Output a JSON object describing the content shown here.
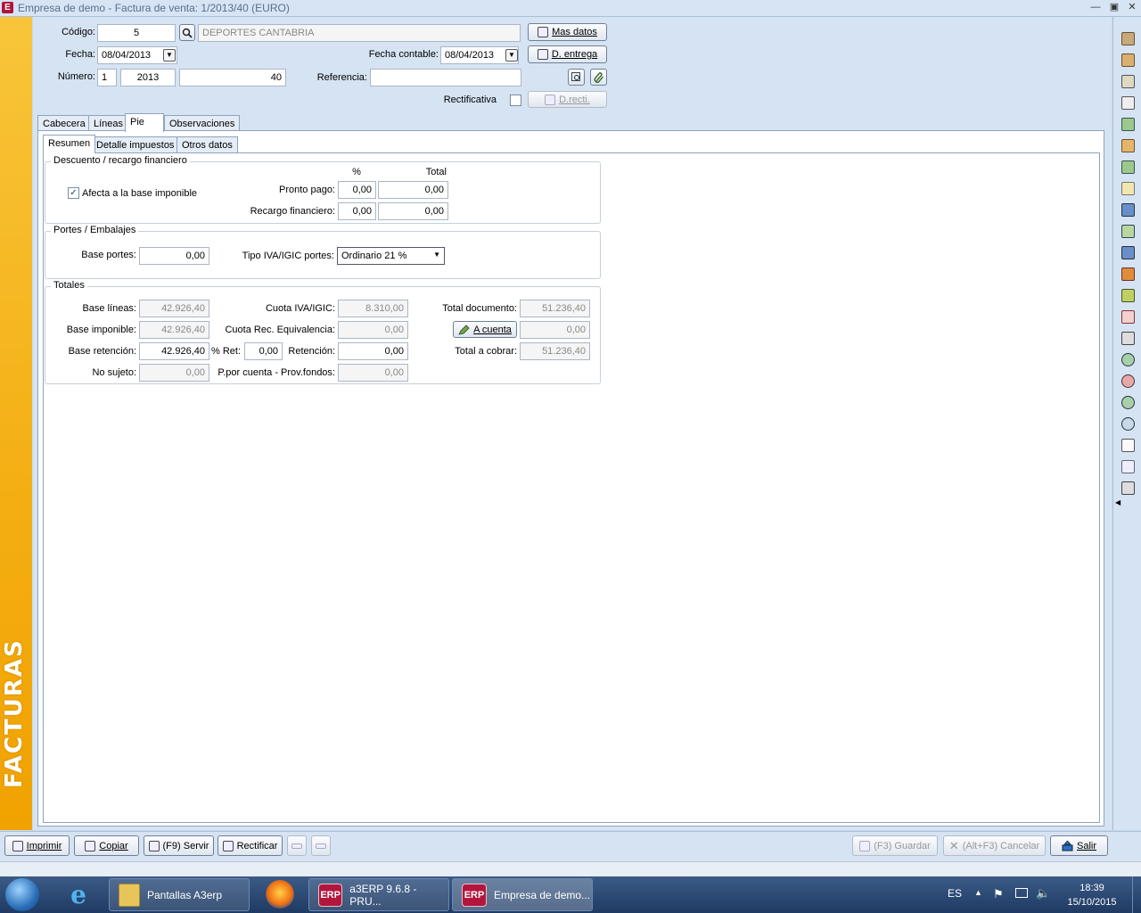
{
  "window": {
    "app_icon_letter": "E",
    "title": "Empresa de demo - Factura de venta: 1/2013/40 (EURO)"
  },
  "banner_text": "FACTURAS",
  "header": {
    "codigo_label": "Código:",
    "codigo_value": "5",
    "cliente_value": "DEPORTES CANTABRIA",
    "mas_datos_label": "Mas datos",
    "fecha_label": "Fecha:",
    "fecha_value": "08/04/2013",
    "fecha_contable_label": "Fecha contable:",
    "fecha_contable_value": "08/04/2013",
    "d_entrega_label": "D. entrega",
    "numero_label": "Número:",
    "numero_serie": "1",
    "numero_anio": "2013",
    "numero_num": "40",
    "referencia_label": "Referencia:",
    "referencia_value": "",
    "rectificativa_label": "Rectificativa",
    "d_recti_label": "D.recti."
  },
  "tabs": [
    "Cabecera",
    "Líneas",
    "Pie",
    "Observaciones"
  ],
  "subtabs": [
    "Resumen",
    "Detalle impuestos",
    "Otros datos"
  ],
  "descuento": {
    "legend": "Descuento / recargo financiero",
    "col_pct": "%",
    "col_total": "Total",
    "afecta_label": "Afecta a la base imponible",
    "afecta_checked": "✓",
    "pronto_label": "Pronto pago:",
    "pronto_pct": "0,00",
    "pronto_total": "0,00",
    "recargo_label": "Recargo financiero:",
    "recargo_pct": "0,00",
    "recargo_total": "0,00"
  },
  "portes": {
    "legend": "Portes / Embalajes",
    "base_label": "Base portes:",
    "base_value": "0,00",
    "tipo_label": "Tipo IVA/IGIC portes:",
    "tipo_value": "Ordinario 21 %"
  },
  "totales": {
    "legend": "Totales",
    "base_lineas_label": "Base líneas:",
    "base_lineas": "42.926,40",
    "base_imponible_label": "Base imponible:",
    "base_imponible": "42.926,40",
    "base_retencion_label": "Base retención:",
    "base_retencion": "42.926,40",
    "pct_ret_label": "% Ret:",
    "pct_ret": "0,00",
    "no_sujeto_label": "No sujeto:",
    "no_sujeto": "0,00",
    "cuota_iva_label": "Cuota IVA/IGIC:",
    "cuota_iva": "8.310,00",
    "cuota_rec_label": "Cuota Rec. Equivalencia:",
    "cuota_rec": "0,00",
    "retencion_label": "Retención:",
    "retencion": "0,00",
    "ppc_label": "P.por cuenta - Prov.fondos:",
    "ppc": "0,00",
    "total_doc_label": "Total documento:",
    "total_doc": "51.236,40",
    "a_cuenta_label": "A cuenta",
    "a_cuenta": "0,00",
    "total_cobrar_label": "Total a cobrar:",
    "total_cobrar": "51.236,40"
  },
  "bottom": {
    "imprimir": "Imprimir",
    "copiar": "Copiar",
    "servir": "(F9) Servir",
    "rectificar": "Rectificar",
    "guardar": "(F3) Guardar",
    "cancelar": "(Alt+F3) Cancelar",
    "salir": "Salir"
  },
  "taskbar": {
    "pantallas": "Pantallas A3erp",
    "erp_icon": "ERP",
    "erp1": "a3ERP 9.6.8 - PRU...",
    "erp2": "Empresa de demo...",
    "lang": "ES",
    "time": "18:39",
    "date": "15/10/2015"
  },
  "colors": {
    "accent_yellow": "#f4ae12",
    "erp_red": "#b2163c",
    "form_bg": "#d5e3f3"
  }
}
